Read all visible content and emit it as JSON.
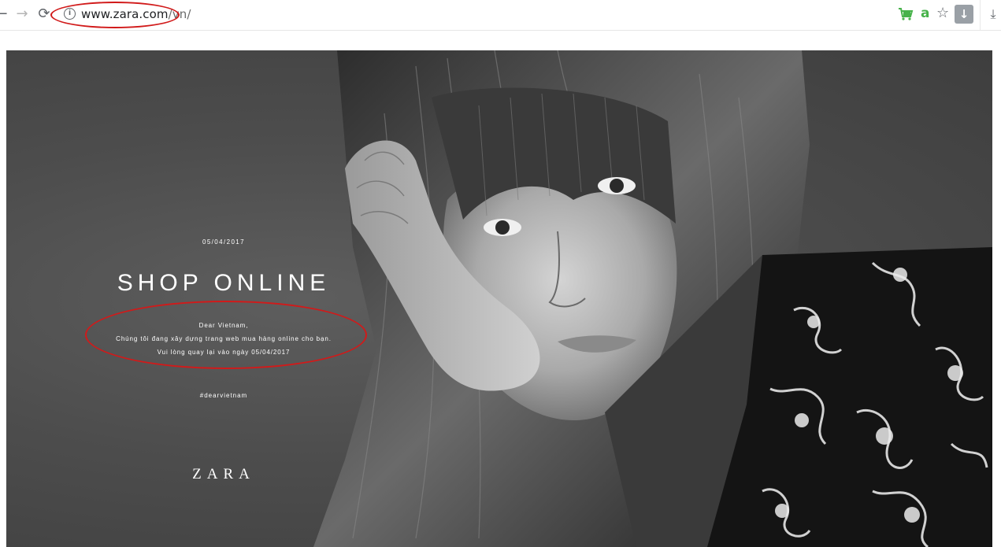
{
  "browser": {
    "back_icon": "←",
    "forward_icon": "→",
    "reload_icon": "⟳",
    "info_icon": "i",
    "url_domain": "www.zara.com",
    "url_path": "/vn/",
    "extension_a": "a",
    "star_icon": "☆",
    "download_ext_icon": "↓",
    "download_icon": "⤓"
  },
  "hero": {
    "date": "05/04/2017",
    "headline": "SHOP ONLINE",
    "message": [
      "Dear Vietnam,",
      "Chúng tôi đang xây dựng trang web mua hàng online cho bạn.",
      "Vui lòng quay lại vào ngày 05/04/2017"
    ],
    "hashtag": "#dearvietnam",
    "logo": "ZARA"
  },
  "colors": {
    "highlight": "#d11a1a",
    "cart_icon": "#47b24a"
  }
}
